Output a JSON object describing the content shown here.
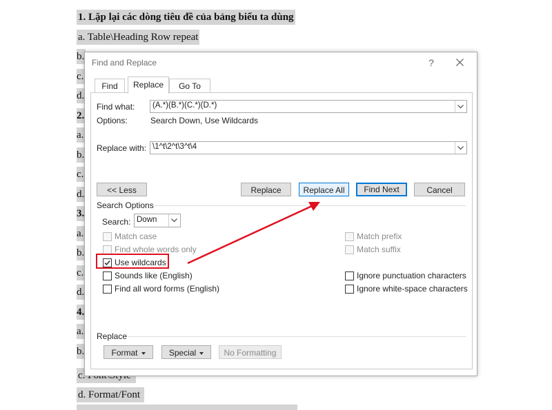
{
  "document": {
    "line1": "1. Lặp lại các dòng tiêu đề của bảng biểu ta dùng",
    "line2": "a. Table\\Heading Row repeat",
    "left_fragments": [
      "b.",
      "c.",
      "d.",
      "2.",
      "a.",
      "b.",
      "c.",
      "d.",
      "3.",
      "a.",
      "b.",
      "c.",
      "d.",
      "4.",
      "a.",
      "b."
    ],
    "line_font_style": "c. Font\\Style",
    "line_format_font": "d. Format/Font"
  },
  "dialog": {
    "title": "Find and Replace",
    "help": "?",
    "tabs": [
      "Find",
      "Replace",
      "Go To"
    ],
    "active_tab": "Replace",
    "find_what_label": "Find what:",
    "find_what_value": "(A.*)(B.*)(C.*)(D.*)",
    "options_label": "Options:",
    "options_value": "Search Down, Use Wildcards",
    "replace_with_label": "Replace with:",
    "replace_with_value": "\\1^t\\2^t\\3^t\\4",
    "buttons": {
      "less": "<< Less",
      "replace": "Replace",
      "replace_all": "Replace All",
      "find_next": "Find Next",
      "cancel": "Cancel"
    },
    "search_options_label": "Search Options",
    "search_label": "Search:",
    "search_value": "Down",
    "checkboxes_left": [
      {
        "label": "Match case",
        "checked": false,
        "enabled": false
      },
      {
        "label": "Find whole words only",
        "checked": false,
        "enabled": false
      },
      {
        "label": "Use wildcards",
        "checked": true,
        "enabled": true
      },
      {
        "label": "Sounds like (English)",
        "checked": false,
        "enabled": true
      },
      {
        "label": "Find all word forms (English)",
        "checked": false,
        "enabled": true
      }
    ],
    "checkboxes_right": [
      {
        "label": "Match prefix",
        "checked": false,
        "enabled": false
      },
      {
        "label": "Match suffix",
        "checked": false,
        "enabled": false
      },
      {
        "label": "Ignore punctuation characters",
        "checked": false,
        "enabled": true
      },
      {
        "label": "Ignore white-space characters",
        "checked": false,
        "enabled": true
      }
    ],
    "replace_section_label": "Replace",
    "format_button": "Format",
    "special_button": "Special",
    "no_formatting_button": "No Formatting"
  },
  "colors": {
    "accent": "#0078d7",
    "annotation": "#e0101e",
    "doc_highlight": "#d4d4d4"
  }
}
